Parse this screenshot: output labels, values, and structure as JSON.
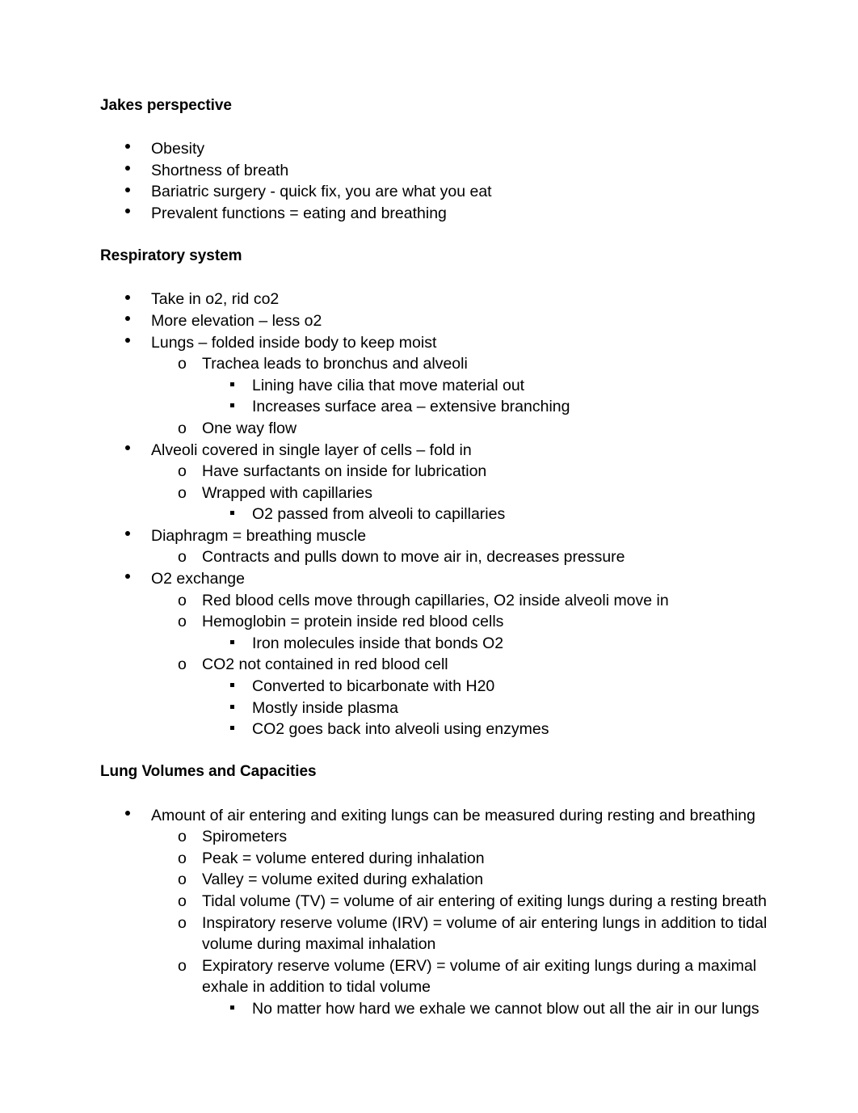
{
  "document": {
    "sections": [
      {
        "heading": "Jakes perspective",
        "items": [
          {
            "level": 1,
            "text": "Obesity"
          },
          {
            "level": 1,
            "text": "Shortness of breath"
          },
          {
            "level": 1,
            "text": "Bariatric surgery -  quick fix, you are what you eat"
          },
          {
            "level": 1,
            "text": "Prevalent functions = eating and breathing"
          }
        ]
      },
      {
        "heading": "Respiratory system",
        "items": [
          {
            "level": 1,
            "text": "Take in o2, rid co2"
          },
          {
            "level": 1,
            "text": "More elevation – less o2"
          },
          {
            "level": 1,
            "text": "Lungs – folded inside body to keep moist"
          },
          {
            "level": 2,
            "text": "Trachea leads to bronchus and alveoli"
          },
          {
            "level": 3,
            "text": "Lining have cilia that move material out"
          },
          {
            "level": 3,
            "text": "Increases surface area – extensive branching"
          },
          {
            "level": 2,
            "text": "One way flow"
          },
          {
            "level": 1,
            "text": "Alveoli covered in single layer of cells – fold in"
          },
          {
            "level": 2,
            "text": "Have surfactants on inside for lubrication"
          },
          {
            "level": 2,
            "text": "Wrapped with capillaries"
          },
          {
            "level": 3,
            "text": "O2 passed from alveoli to capillaries"
          },
          {
            "level": 1,
            "text": "Diaphragm = breathing muscle"
          },
          {
            "level": 2,
            "text": "Contracts and pulls down to move air in, decreases pressure"
          },
          {
            "level": 1,
            "text": "O2 exchange"
          },
          {
            "level": 2,
            "text": "Red blood cells move through capillaries, O2 inside alveoli move in"
          },
          {
            "level": 2,
            "text": "Hemoglobin = protein inside red blood cells"
          },
          {
            "level": 3,
            "text": "Iron molecules inside that bonds O2"
          },
          {
            "level": 2,
            "text": "CO2 not contained in red blood cell"
          },
          {
            "level": 3,
            "text": "Converted to bicarbonate with H20"
          },
          {
            "level": 3,
            "text": "Mostly inside plasma"
          },
          {
            "level": 3,
            "text": "CO2 goes back into alveoli using enzymes"
          }
        ]
      },
      {
        "heading": "Lung Volumes and Capacities",
        "items": [
          {
            "level": 1,
            "text": "Amount of air entering and exiting lungs can be measured during resting and breathing"
          },
          {
            "level": 2,
            "text": "Spirometers"
          },
          {
            "level": 2,
            "text": "Peak = volume entered during inhalation"
          },
          {
            "level": 2,
            "text": "Valley = volume exited during exhalation"
          },
          {
            "level": 2,
            "text": "Tidal volume (TV) = volume of air entering of exiting lungs during a resting breath"
          },
          {
            "level": 2,
            "text": "Inspiratory reserve volume (IRV) = volume of air entering lungs in addition to tidal volume during maximal inhalation"
          },
          {
            "level": 2,
            "text": "Expiratory reserve volume (ERV) = volume of air exiting lungs during a maximal exhale in addition to tidal volume"
          },
          {
            "level": 3,
            "text": "No matter how hard we exhale we cannot blow out all the air in our lungs"
          }
        ]
      }
    ],
    "markers": {
      "level1": "•",
      "level2": "o",
      "level3": "▪"
    }
  }
}
